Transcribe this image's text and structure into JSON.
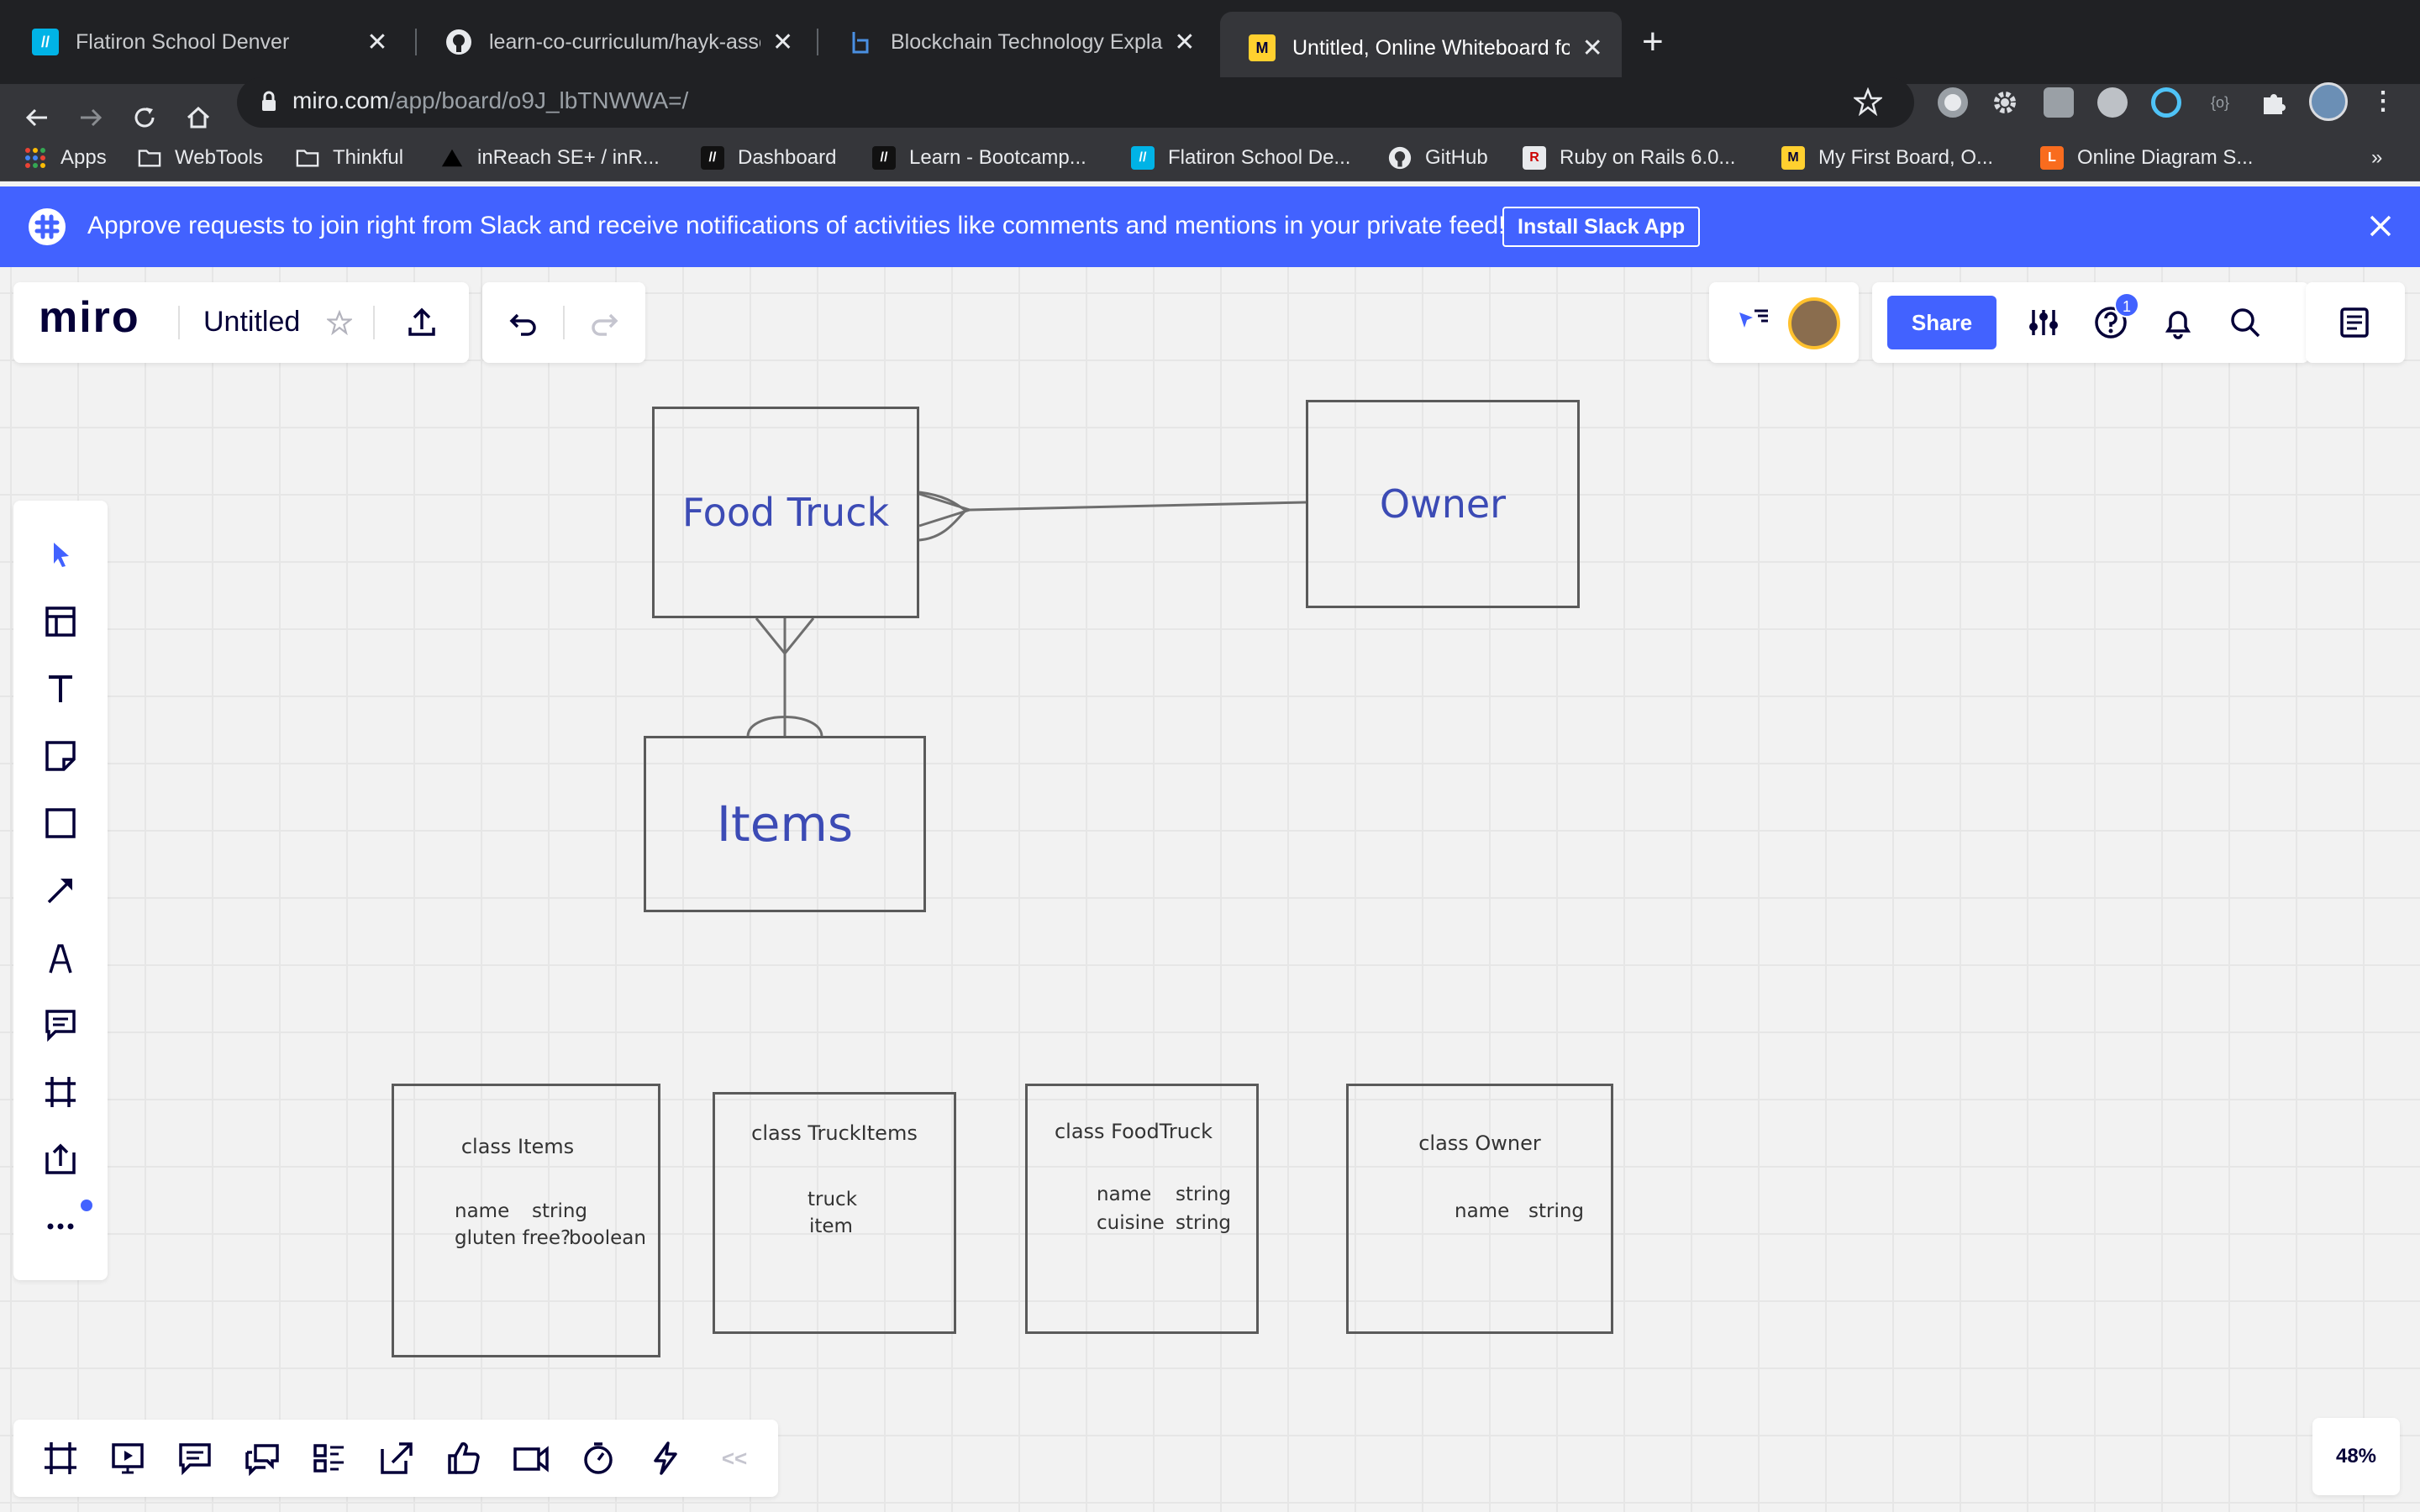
{
  "browser": {
    "tabs": [
      {
        "title": "Flatiron School Denver",
        "icon": "flatiron-icon",
        "active": false
      },
      {
        "title": "learn-co-curriculum/hayk-asse",
        "icon": "github-icon",
        "active": false
      },
      {
        "title": "Blockchain Technology Explain",
        "icon": "blog-icon",
        "active": false
      },
      {
        "title": "Untitled, Online Whiteboard fo",
        "icon": "miro-icon",
        "active": true
      }
    ],
    "url_host": "miro.com",
    "url_path": "/app/board/o9J_lbTNWWA=/",
    "bookmarks": [
      {
        "label": "Apps",
        "icon": "apps-grid-icon"
      },
      {
        "label": "WebTools",
        "icon": "folder-icon"
      },
      {
        "label": "Thinkful",
        "icon": "folder-icon"
      },
      {
        "label": "inReach SE+ / inR...",
        "icon": "triangle-icon"
      },
      {
        "label": "Dashboard",
        "icon": "flatiron-icon"
      },
      {
        "label": "Learn - Bootcamp...",
        "icon": "flatiron-icon"
      },
      {
        "label": "Flatiron School De...",
        "icon": "flatiron-icon"
      },
      {
        "label": "GitHub",
        "icon": "github-icon"
      },
      {
        "label": "Ruby on Rails 6.0...",
        "icon": "rails-icon"
      },
      {
        "label": "My First Board, O...",
        "icon": "miro-icon"
      },
      {
        "label": "Online Diagram S...",
        "icon": "lucid-icon"
      }
    ],
    "more_bookmarks": "»"
  },
  "banner": {
    "message": "Approve requests to join right from Slack and receive notifications of activities like comments and mentions in your private feed!",
    "button": "Install Slack App"
  },
  "miro": {
    "logo": "miro",
    "board_name": "Untitled",
    "share_label": "Share",
    "help_badge": "1",
    "zoom": "48%",
    "collapse_label": "<<"
  },
  "diagram": {
    "entities": {
      "food_truck": "Food Truck",
      "owner": "Owner",
      "items": "Items"
    },
    "classes": [
      {
        "title": "class Items",
        "fields": [
          [
            "name",
            "string"
          ],
          [
            "gluten free?",
            "boolean"
          ]
        ]
      },
      {
        "title": "class TruckItems",
        "fields": [
          [
            "truck",
            ""
          ],
          [
            "item",
            ""
          ]
        ]
      },
      {
        "title": "class FoodTruck",
        "fields": [
          [
            "name",
            "string"
          ],
          [
            "cuisine",
            "string"
          ]
        ]
      },
      {
        "title": "class Owner",
        "fields": [
          [
            "name",
            "string"
          ]
        ]
      }
    ]
  },
  "colors": {
    "accent": "#4262ff",
    "diagram_text": "#3c4bb5",
    "chrome_dark": "#202124"
  }
}
